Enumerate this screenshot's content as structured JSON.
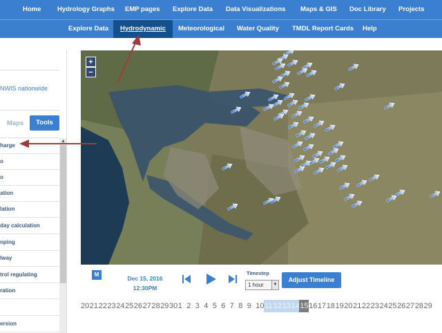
{
  "topnav": {
    "items": [
      "Home",
      "Hydrology Graphs",
      "EMP pages",
      "Explore Data",
      "Data Visualizations",
      "Maps & GIS",
      "Doc Library",
      "Projects"
    ]
  },
  "subnav": {
    "items": [
      "Explore Data",
      "Hydrodynamic",
      "Meteorological",
      "Water Quality",
      "TMDL Report Cards",
      "Help"
    ],
    "active": "Hydrodynamic"
  },
  "sidebar": {
    "nwis_text": "NWIS nationwide",
    "tabs": {
      "maps": "Maps",
      "tools": "Tools"
    },
    "tools": [
      "harge",
      "o",
      "ation",
      "lation",
      "day calculation",
      "nping",
      "lway",
      "trol regulating",
      "ration",
      "",
      "ersion"
    ]
  },
  "map": {
    "zoom_in": "+",
    "zoom_out": "−"
  },
  "timeline": {
    "m_button": "M",
    "date": "Dec 15, 2016",
    "time": "12:30PM",
    "timestep_label": "Timestep",
    "timestep_value": "1 hour",
    "adjust_button": "Adjust Timeline",
    "days": [
      "20",
      "21",
      "22",
      "23",
      "24",
      "25",
      "26",
      "27",
      "28",
      "29",
      "30",
      "1",
      "2",
      "3",
      "4",
      "5",
      "6",
      "7",
      "8",
      "9",
      "10",
      "11",
      "12",
      "13",
      "14",
      "15",
      "16",
      "17",
      "18",
      "19",
      "20",
      "21",
      "22",
      "23",
      "24",
      "25",
      "26",
      "27",
      "28",
      "29"
    ],
    "current_day": "15"
  },
  "colors": {
    "nav_blue": "#3a7fd0",
    "nav_active": "#14508e",
    "annotation_arrow": "#a33a3a"
  }
}
